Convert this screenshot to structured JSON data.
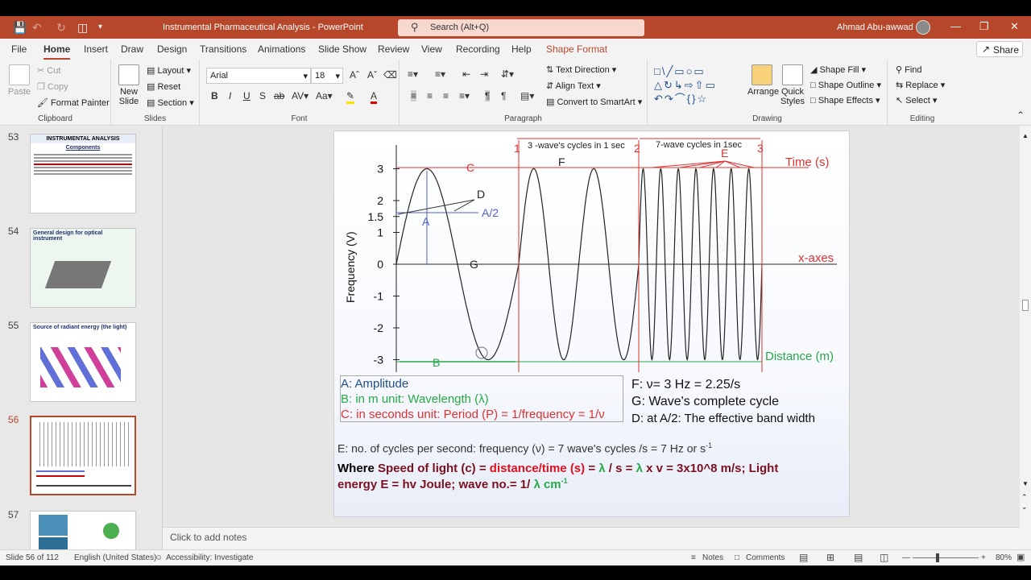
{
  "app": {
    "doc_title": "Instrumental Pharmaceutical Analysis - PowerPoint",
    "search_placeholder": "Search (Alt+Q)",
    "user_name": "Ahmad Abu-awwad",
    "brand_color": "#b7472a"
  },
  "menu": {
    "tabs": [
      "File",
      "Home",
      "Insert",
      "Draw",
      "Design",
      "Transitions",
      "Animations",
      "Slide Show",
      "Review",
      "View",
      "Recording",
      "Help",
      "Shape Format"
    ],
    "active": "Home",
    "share": "Share"
  },
  "ribbon": {
    "clipboard": {
      "paste": "Paste",
      "cut": "Cut",
      "copy": "Copy",
      "format_painter": "Format Painter",
      "label": "Clipboard"
    },
    "slides": {
      "new_slide": "New Slide",
      "layout": "Layout",
      "reset": "Reset",
      "section": "Section",
      "label": "Slides"
    },
    "font": {
      "name": "Arial",
      "size": "18",
      "label": "Font"
    },
    "paragraph": {
      "text_direction": "Text Direction",
      "align_text": "Align Text",
      "convert_smartart": "Convert to SmartArt",
      "label": "Paragraph"
    },
    "drawing": {
      "arrange": "Arrange",
      "quick_styles": "Quick Styles",
      "shape_fill": "Shape Fill",
      "shape_outline": "Shape Outline",
      "shape_effects": "Shape Effects",
      "label": "Drawing"
    },
    "editing": {
      "find": "Find",
      "replace": "Replace",
      "select": "Select",
      "label": "Editing"
    }
  },
  "thumbnails": [
    {
      "num": "53",
      "title": "INSTRUMENTAL ANALYSIS",
      "subtitle": "Components"
    },
    {
      "num": "54",
      "title": "General design for optical instrument"
    },
    {
      "num": "55",
      "title": "Source of radiant energy (the light)"
    },
    {
      "num": "56",
      "selected": true
    },
    {
      "num": "57"
    }
  ],
  "slide": {
    "plot": {
      "y_label": "Frequency (V)",
      "y_ticks": [
        "3",
        "2",
        "1.5",
        "1",
        "0",
        "-1",
        "-2",
        "-3"
      ],
      "time_label": "Time (s)",
      "x_axis_label": "x-axes",
      "distance_label": "Distance (m)",
      "marks": [
        "1",
        "2",
        "3"
      ],
      "top_note_1": "3 -wave's cycles in 1 sec",
      "top_note_2": "7-wave cycles in 1sec",
      "letters": {
        "C": "C",
        "F": "F",
        "E": "E",
        "D": "D",
        "A": "A",
        "A2": "A/2",
        "G": "G",
        "B": "B"
      }
    },
    "legend_left": [
      "A: Amplitude",
      "B: in m unit: Wavelength (λ)",
      "C: in seconds unit: Period (P) = 1/frequency = 1/ν"
    ],
    "legend_right": [
      "F: ν= 3 Hz = 2.25/s",
      "G: Wave's complete cycle",
      "D: at A/2: The effective band width"
    ],
    "freq_line": "E: no. of cycles per second: frequency (ν) = 7 wave's cycles /s = 7  Hz or s",
    "freq_sup": "-1",
    "where": {
      "p1": "Where ",
      "p2": "Speed of light (c) = ",
      "p3": "distance/time (s)",
      "p4": " = ",
      "p5": "λ",
      "p6": " / s = ",
      "p7": "λ",
      "p8": " x v = 3x10^8 m/s; Light",
      "line2a": "energy E = hv Joule; wave no.= 1/ ",
      "line2b": "λ cm",
      "line2sup": "-1"
    }
  },
  "notes_placeholder": "Click to add notes",
  "status": {
    "slide_of": "Slide 56 of 112",
    "language": "English (United States)",
    "accessibility": "Accessibility: Investigate",
    "notes": "Notes",
    "comments": "Comments",
    "zoom": "80%"
  }
}
